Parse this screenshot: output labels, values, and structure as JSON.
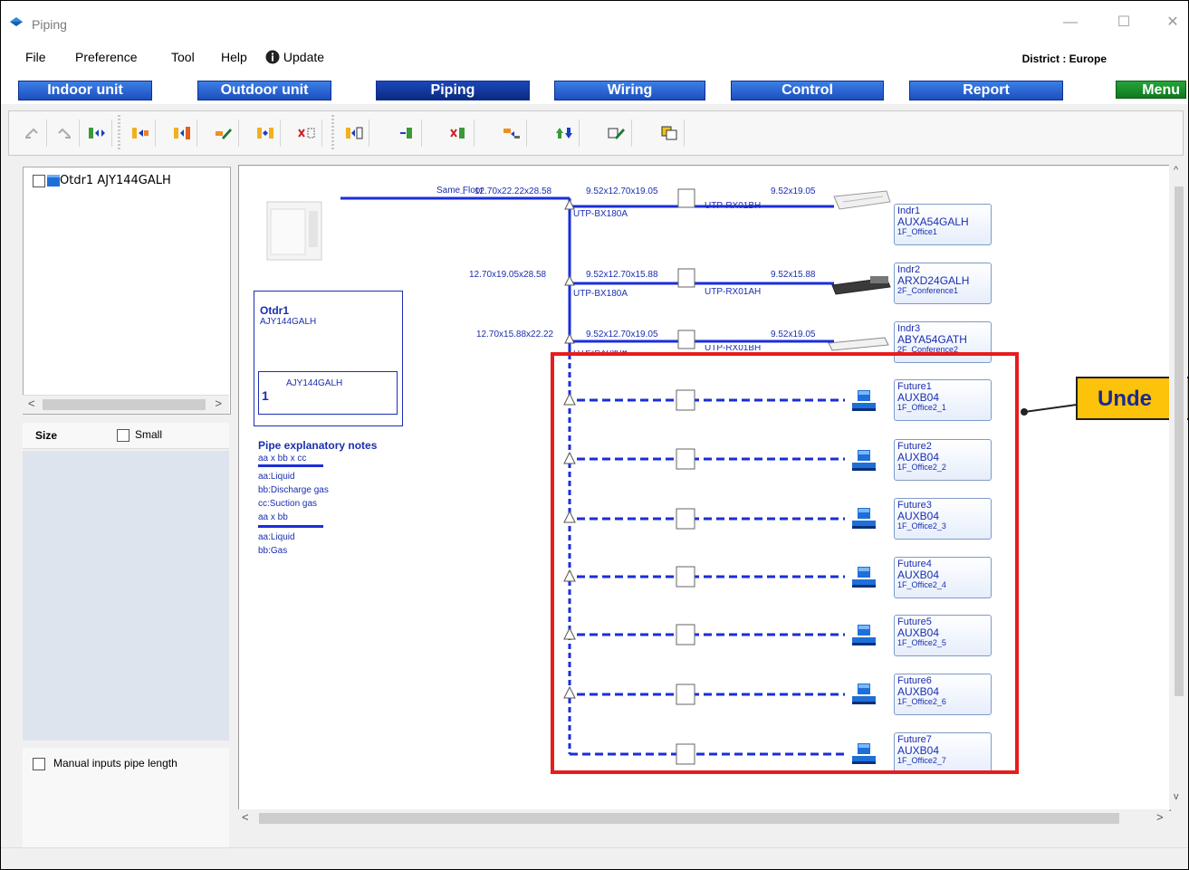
{
  "window": {
    "title": "Piping",
    "minimize": "—",
    "maximize": "☐",
    "close": "✕"
  },
  "menu": {
    "items": [
      "File",
      "Preference",
      "Tool",
      "Help",
      "Update"
    ],
    "district": "District : Europe"
  },
  "nav_tabs": [
    "Indoor unit",
    "Outdoor unit",
    "Piping",
    "Wiring",
    "Control",
    "Report",
    "Menu"
  ],
  "active_tab": "Piping",
  "toolbar_icons": [
    "undo-icon",
    "redo-icon",
    "swap-icon",
    "move-right-icon",
    "move-right-block-icon",
    "edit-pipe-icon",
    "exchange-icon",
    "delete-branch-icon",
    "insert-header-icon",
    "header-icon",
    "delete-header-icon",
    "transfer-icon",
    "up-down-icon",
    "edit-icon",
    "properties-icon"
  ],
  "left_panel": {
    "tree_item": "Otdr1 AJY144GALH",
    "size_label": "Size",
    "small_label": "Small",
    "manual_label": "Manual inputs pipe length"
  },
  "diagram": {
    "same_floor": "Same Floor",
    "outdoor": {
      "name": "Otdr1",
      "model": "AJY144GALH",
      "inner_model": "AJY144GALH",
      "count": "1"
    },
    "notes": {
      "title": "Pipe explanatory notes",
      "format3": "aa x bb x cc",
      "lines3": [
        "aa:Liquid",
        "bb:Discharge gas",
        "cc:Suction gas"
      ],
      "format2": "aa x bb",
      "lines2": [
        "aa:Liquid",
        "bb:Gas"
      ]
    },
    "arrow": "→",
    "pipes": {
      "main1": "12.70x22.22x28.58",
      "main2": "12.70x19.05x28.58",
      "main3": "12.70x15.88x22.22",
      "branch1": "9.52x12.70x19.05",
      "branch2": "9.52x12.70x15.88",
      "branch3": "9.52x12.70x19.05",
      "ind1": "9.52x19.05",
      "ind2": "9.52x15.88",
      "ind3": "9.52x19.05"
    },
    "kits": {
      "bx1": "UTP-BX180A",
      "bx2": "UTP-BX180A",
      "bx3": "UTP-BX090A",
      "rx1": "UTP-RX01BH",
      "rx2": "UTP-RX01AH",
      "rx3": "UTP-RX01BH"
    },
    "indoor_units": [
      {
        "name": "Indr1",
        "model": "AUXA54GALH",
        "room": "1F_Office1"
      },
      {
        "name": "Indr2",
        "model": "ARXD24GALH",
        "room": "2F_Conference1"
      },
      {
        "name": "Indr3",
        "model": "ABYA54GATH",
        "room": "2F_Conference2"
      }
    ],
    "future_units": [
      {
        "name": "Future1",
        "model": "AUXB04",
        "room": "1F_Office2_1"
      },
      {
        "name": "Future2",
        "model": "AUXB04",
        "room": "1F_Office2_2"
      },
      {
        "name": "Future3",
        "model": "AUXB04",
        "room": "1F_Office2_3"
      },
      {
        "name": "Future4",
        "model": "AUXB04",
        "room": "1F_Office2_4"
      },
      {
        "name": "Future5",
        "model": "AUXB04",
        "room": "1F_Office2_5"
      },
      {
        "name": "Future6",
        "model": "AUXB04",
        "room": "1F_Office2_6"
      },
      {
        "name": "Future7",
        "model": "AUXB04",
        "room": "1F_Office2_7"
      }
    ]
  },
  "callout": {
    "text": "Unde"
  },
  "colors": {
    "pipe": "#1a2ed8",
    "highlight": "#e81c1c",
    "callout_bg": "#fdc20a",
    "tab_blue": "#1d4fbe"
  }
}
